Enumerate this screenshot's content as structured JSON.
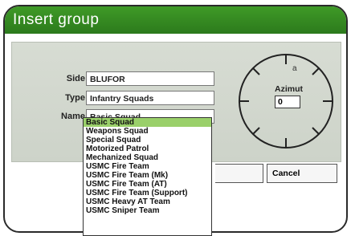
{
  "window": {
    "title": "Insert group"
  },
  "fields": {
    "side": {
      "label": "Side",
      "value": "BLUFOR"
    },
    "type": {
      "label": "Type",
      "value": "Infantry Squads"
    },
    "name": {
      "label": "Name",
      "value": "Basic Squad"
    }
  },
  "azimuth": {
    "label": "Azimut",
    "value": "0",
    "dial_mark": "a"
  },
  "buttons": {
    "cancel": "Cancel"
  },
  "dropdown": {
    "items": [
      "Basic Squad",
      "Weapons Squad",
      "Special Squad",
      "Motorized Patrol",
      "Mechanized Squad",
      "USMC Fire Team",
      "USMC Fire Team (Mk)",
      "USMC Fire Team (AT)",
      "USMC Fire Team (Support)",
      "USMC Heavy AT Team",
      "USMC Sniper Team"
    ],
    "selected_index": 0
  },
  "colors": {
    "title_bar": "#3a8f24",
    "panel": "#d3d8cf",
    "selected_item": "#9ad06a"
  }
}
